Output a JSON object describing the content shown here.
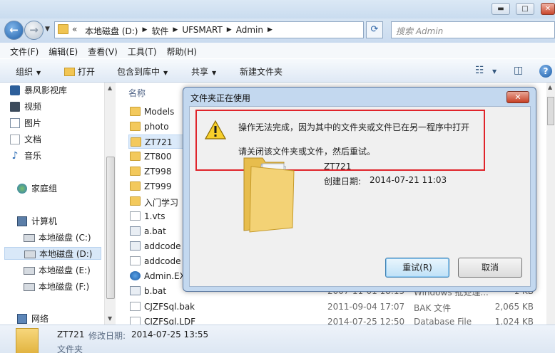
{
  "window": {
    "controls": {
      "minimize": "▬",
      "maximize": "□",
      "close": "✕"
    }
  },
  "address": {
    "chevron": "«",
    "crumbs": [
      "本地磁盘 (D:)",
      "软件",
      "UFSMART",
      "Admin"
    ],
    "search_placeholder": "搜索 Admin"
  },
  "menu": [
    "文件(F)",
    "编辑(E)",
    "查看(V)",
    "工具(T)",
    "帮助(H)"
  ],
  "toolbar": {
    "organize": "组织",
    "open": "打开",
    "include": "包含到库中",
    "share": "共享",
    "new_folder": "新建文件夹"
  },
  "nav": {
    "items": [
      {
        "label": "暴风影视库",
        "icon": "video-library-icon"
      },
      {
        "label": "视频",
        "icon": "video-icon"
      },
      {
        "label": "图片",
        "icon": "picture-icon"
      },
      {
        "label": "文档",
        "icon": "document-icon"
      },
      {
        "label": "音乐",
        "icon": "music-icon"
      }
    ],
    "homegroup": "家庭组",
    "computer": "计算机",
    "drives": [
      "本地磁盘 (C:)",
      "本地磁盘 (D:)",
      "本地磁盘 (E:)",
      "本地磁盘 (F:)"
    ],
    "network": "网络"
  },
  "list": {
    "column_name": "名称",
    "rows": [
      {
        "name": "Models",
        "icon": "folder"
      },
      {
        "name": "photo",
        "icon": "folder"
      },
      {
        "name": "ZT721",
        "icon": "folder"
      },
      {
        "name": "ZT800",
        "icon": "folder"
      },
      {
        "name": "ZT998",
        "icon": "folder"
      },
      {
        "name": "ZT999",
        "icon": "folder"
      },
      {
        "name": "入门学习",
        "icon": "folder"
      },
      {
        "name": "1.vts",
        "icon": "doc"
      },
      {
        "name": "a.bat",
        "icon": "gear"
      },
      {
        "name": "addcode",
        "icon": "gear"
      },
      {
        "name": "addcode",
        "icon": "doc"
      },
      {
        "name": "Admin.EX",
        "icon": "ie"
      },
      {
        "name": "b.bat",
        "icon": "gear",
        "date": "2007-11-01 18:15",
        "type": "Windows 批处理...",
        "size": "1 KB"
      },
      {
        "name": "CJZFSql.bak",
        "icon": "doc",
        "date": "2011-09-04 17:07",
        "type": "BAK 文件",
        "size": "2,065 KB"
      },
      {
        "name": "CJZFSql.LDF",
        "icon": "doc",
        "date": "2014-07-25 12:50",
        "type": "Database File",
        "size": "1,024 KB"
      }
    ]
  },
  "details": {
    "name": "ZT721",
    "modified_label": "修改日期:",
    "modified_value": "2014-07-25 13:55",
    "type": "文件夹"
  },
  "dialog": {
    "title": "文件夹正在使用",
    "message": "操作无法完成，因为其中的文件夹或文件已在另一程序中打开",
    "instruction": "请关闭该文件夹或文件，然后重试。",
    "item_name": "ZT721",
    "created_label": "创建日期:",
    "created_value": "2014-07-21 11:03",
    "retry": "重试(R)",
    "cancel": "取消"
  }
}
